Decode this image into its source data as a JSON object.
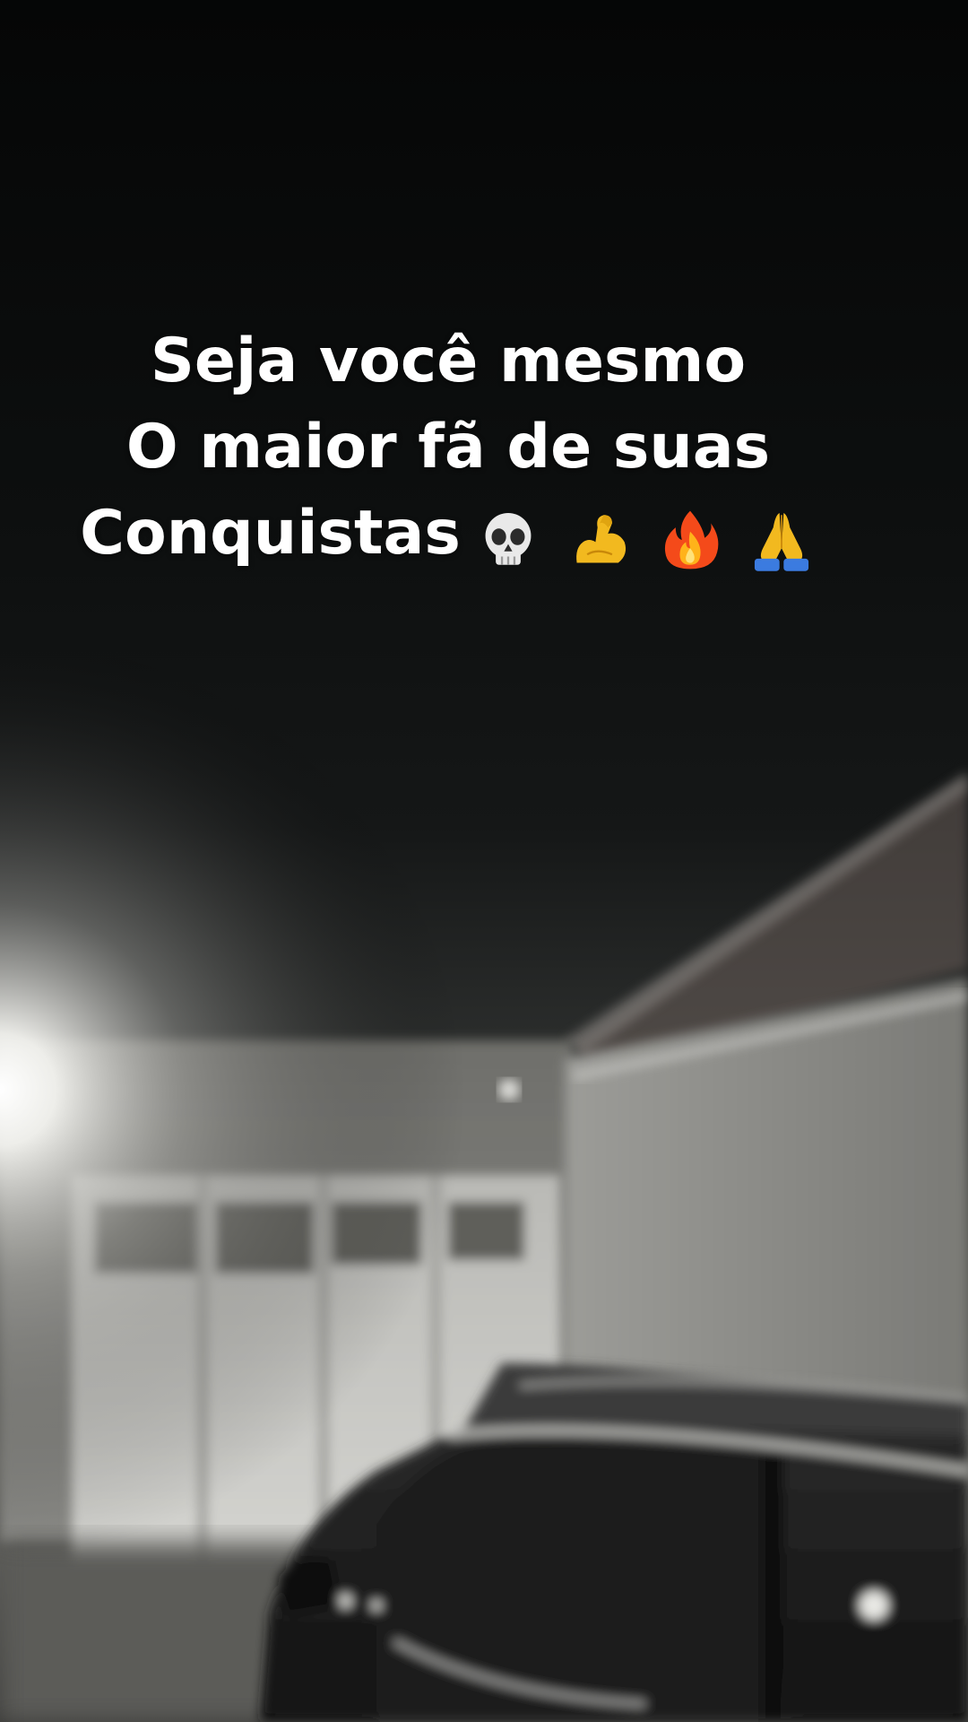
{
  "caption": {
    "lines": [
      "Seja você mesmo",
      "O maior fã de suas",
      "Conquistas"
    ],
    "emojis": [
      "skull-icon",
      "flexed-biceps-icon",
      "fire-icon",
      "folded-hands-icon"
    ]
  },
  "scene": {
    "description_icons": [
      "night-sky",
      "house-wall",
      "garage-door",
      "parked-car",
      "street-light"
    ]
  }
}
